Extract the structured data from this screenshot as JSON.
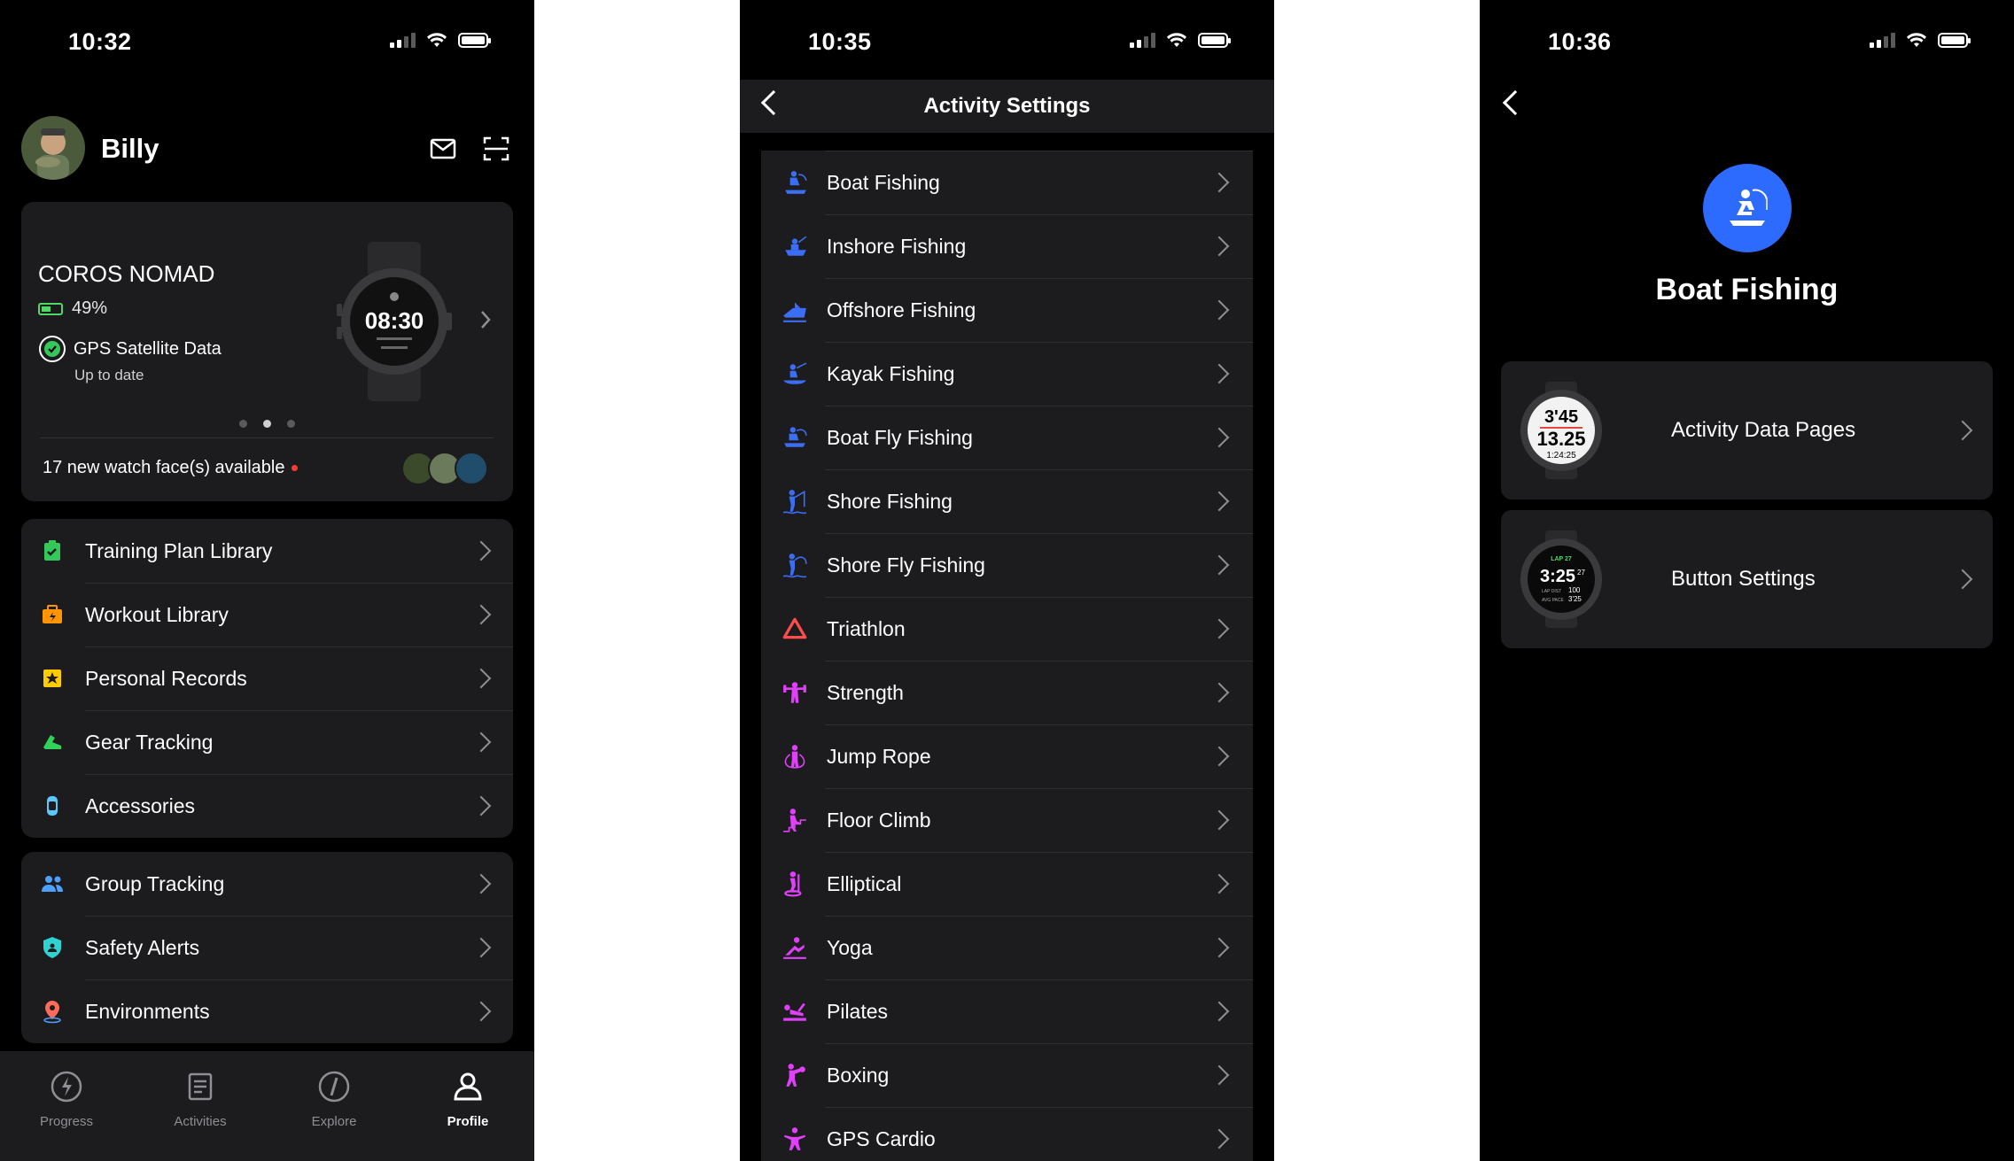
{
  "screen1": {
    "status": {
      "time": "10:32"
    },
    "user": {
      "name": "Billy"
    },
    "device": {
      "name": "COROS NOMAD",
      "battery": "49%",
      "gps_label": "GPS Satellite Data",
      "gps_status": "Up to date",
      "watch_time": "08:30",
      "faces_text": "17 new watch face(s) available",
      "carousel_count": 3,
      "carousel_active": 2
    },
    "menu1": [
      {
        "label": "Training Plan Library",
        "icon": "training-plan-icon",
        "color": "#34c759"
      },
      {
        "label": "Workout Library",
        "icon": "workout-icon",
        "color": "#ff9500"
      },
      {
        "label": "Personal Records",
        "icon": "records-icon",
        "color": "#ffcc00"
      },
      {
        "label": "Gear Tracking",
        "icon": "shoe-icon",
        "color": "#30d158"
      },
      {
        "label": "Accessories",
        "icon": "accessory-icon",
        "color": "#5ac8fa"
      }
    ],
    "menu2": [
      {
        "label": "Group Tracking",
        "icon": "group-icon",
        "color": "#4ea0ff"
      },
      {
        "label": "Safety Alerts",
        "icon": "shield-icon",
        "color": "#30d1d1"
      },
      {
        "label": "Environments",
        "icon": "location-pin-icon",
        "color": "#ff6b5b"
      }
    ],
    "tabs": [
      {
        "label": "Progress",
        "icon": "progress-icon",
        "active": false
      },
      {
        "label": "Activities",
        "icon": "activities-icon",
        "active": false
      },
      {
        "label": "Explore",
        "icon": "explore-icon",
        "active": false
      },
      {
        "label": "Profile",
        "icon": "profile-icon",
        "active": true
      }
    ]
  },
  "screen2": {
    "status": {
      "time": "10:35"
    },
    "title": "Activity Settings",
    "activities": [
      {
        "label": "Boat Fishing",
        "icon": "boat-fishing-icon",
        "color": "#3b6ef5"
      },
      {
        "label": "Inshore Fishing",
        "icon": "inshore-fishing-icon",
        "color": "#3b6ef5"
      },
      {
        "label": "Offshore Fishing",
        "icon": "offshore-fishing-icon",
        "color": "#3b6ef5"
      },
      {
        "label": "Kayak Fishing",
        "icon": "kayak-fishing-icon",
        "color": "#3b6ef5"
      },
      {
        "label": "Boat Fly Fishing",
        "icon": "boat-fly-fishing-icon",
        "color": "#3b6ef5"
      },
      {
        "label": "Shore Fishing",
        "icon": "shore-fishing-icon",
        "color": "#3b6ef5"
      },
      {
        "label": "Shore Fly Fishing",
        "icon": "shore-fly-fishing-icon",
        "color": "#3b6ef5"
      },
      {
        "label": "Triathlon",
        "icon": "triathlon-icon",
        "color": "#ff4d4d"
      },
      {
        "label": "Strength",
        "icon": "strength-icon",
        "color": "#e040fb"
      },
      {
        "label": "Jump Rope",
        "icon": "jump-rope-icon",
        "color": "#e040fb"
      },
      {
        "label": "Floor Climb",
        "icon": "floor-climb-icon",
        "color": "#e040fb"
      },
      {
        "label": "Elliptical",
        "icon": "elliptical-icon",
        "color": "#e040fb"
      },
      {
        "label": "Yoga",
        "icon": "yoga-icon",
        "color": "#e040fb"
      },
      {
        "label": "Pilates",
        "icon": "pilates-icon",
        "color": "#e040fb"
      },
      {
        "label": "Boxing",
        "icon": "boxing-icon",
        "color": "#e040fb"
      },
      {
        "label": "GPS Cardio",
        "icon": "gps-cardio-icon",
        "color": "#e040fb"
      }
    ]
  },
  "screen3": {
    "status": {
      "time": "10:36"
    },
    "title": "Boat Fishing",
    "accent": "#2d6bff",
    "items": [
      {
        "label": "Activity Data Pages",
        "watch_top": "3'45",
        "watch_mid": "13.25",
        "watch_bot": "1:24:25"
      },
      {
        "label": "Button Settings",
        "watch_top": "LAP 27",
        "watch_mid": "3:25",
        "watch_sup": "27",
        "watch_r1l": "LAP DIST",
        "watch_r1": "100",
        "watch_r2l": "AVG PACE",
        "watch_r2": "3'25"
      }
    ]
  }
}
